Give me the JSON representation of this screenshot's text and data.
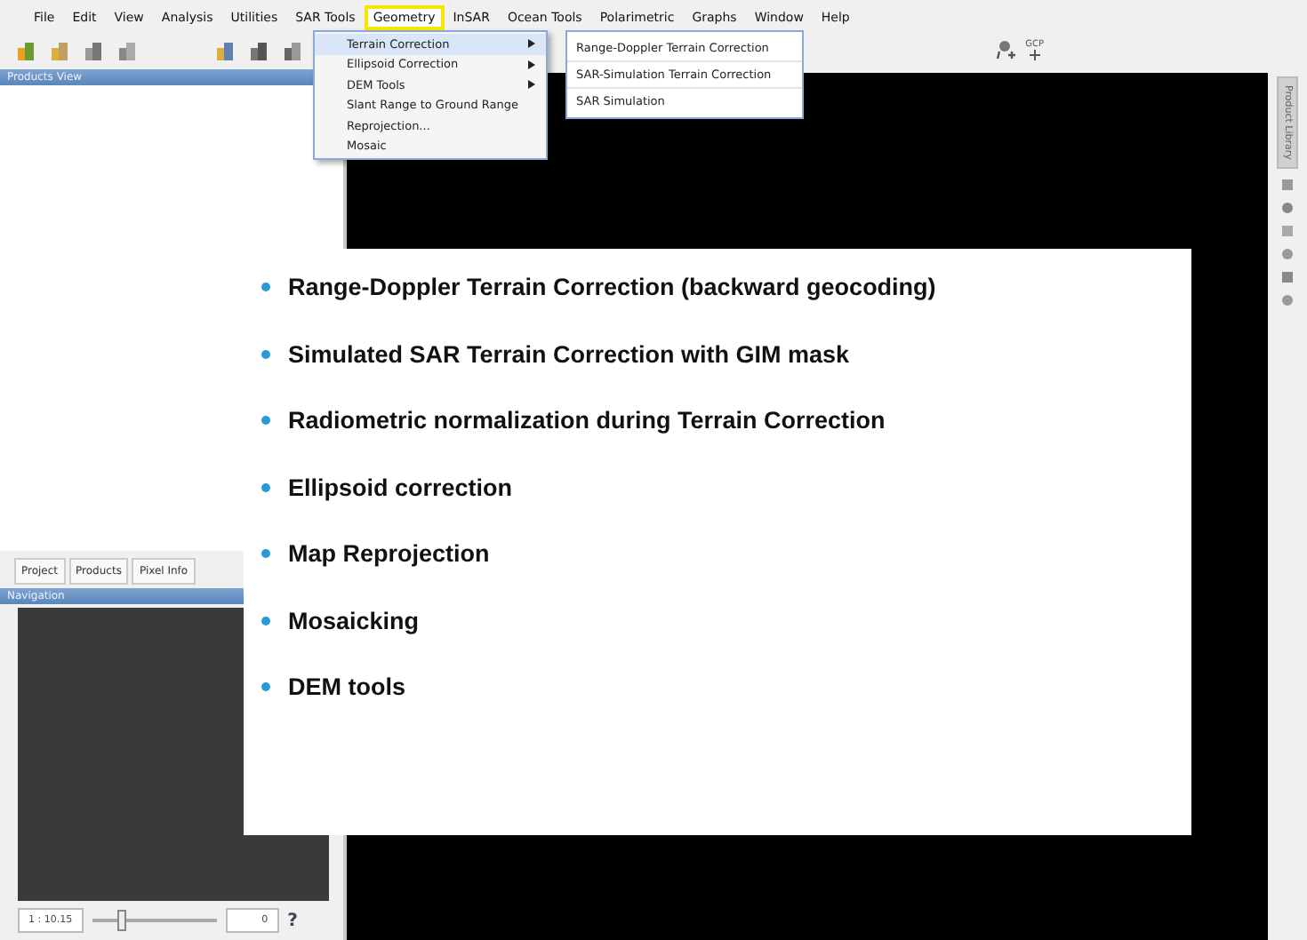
{
  "menu_bar": [
    {
      "label": "File",
      "selected": false
    },
    {
      "label": "Edit",
      "selected": false
    },
    {
      "label": "View",
      "selected": false
    },
    {
      "label": "Analysis",
      "selected": false
    },
    {
      "label": "Utilities",
      "selected": false
    },
    {
      "label": "SAR Tools",
      "selected": false
    },
    {
      "label": "Geometry",
      "selected": true
    },
    {
      "label": "InSAR",
      "selected": false
    },
    {
      "label": "Ocean Tools",
      "selected": false
    },
    {
      "label": "Polarimetric",
      "selected": false
    },
    {
      "label": "Graphs",
      "selected": false
    },
    {
      "label": "Window",
      "selected": false
    },
    {
      "label": "Help",
      "selected": false
    }
  ],
  "geometry_menu": [
    {
      "label": "Terrain Correction",
      "submenu": true,
      "selected": true
    },
    {
      "label": "Ellipsoid Correction",
      "submenu": true,
      "selected": false
    },
    {
      "label": "DEM Tools",
      "submenu": true,
      "selected": false
    },
    {
      "label": "Slant Range to Ground Range",
      "submenu": false,
      "selected": false
    },
    {
      "label": "Reprojection...",
      "submenu": false,
      "selected": false
    },
    {
      "label": "Mosaic",
      "submenu": false,
      "selected": false
    }
  ],
  "terrain_correction_submenu": [
    "Range-Doppler Terrain Correction",
    "SAR-Simulation Terrain Correction",
    "SAR Simulation"
  ],
  "toolbar": {
    "gcp_label": "GCP"
  },
  "products_view": {
    "title": "Products View"
  },
  "panel_tabs": [
    "Project",
    "Products",
    "Pixel Info"
  ],
  "navigation": {
    "title": "Navigation",
    "zoom_field": "1 : 10.15",
    "slider": {
      "level": 0.2
    },
    "value_field": "0",
    "help": "?"
  },
  "product_library": {
    "title": "Product Library"
  },
  "overlay": {
    "bullets": [
      "Range-Doppler Terrain Correction (backward geocoding)",
      "Simulated SAR Terrain Correction with GIM mask",
      "Radiometric normalization during Terrain Correction",
      "Ellipsoid correction",
      "Map Reprojection",
      "Mosaicking",
      "DEM tools"
    ]
  }
}
